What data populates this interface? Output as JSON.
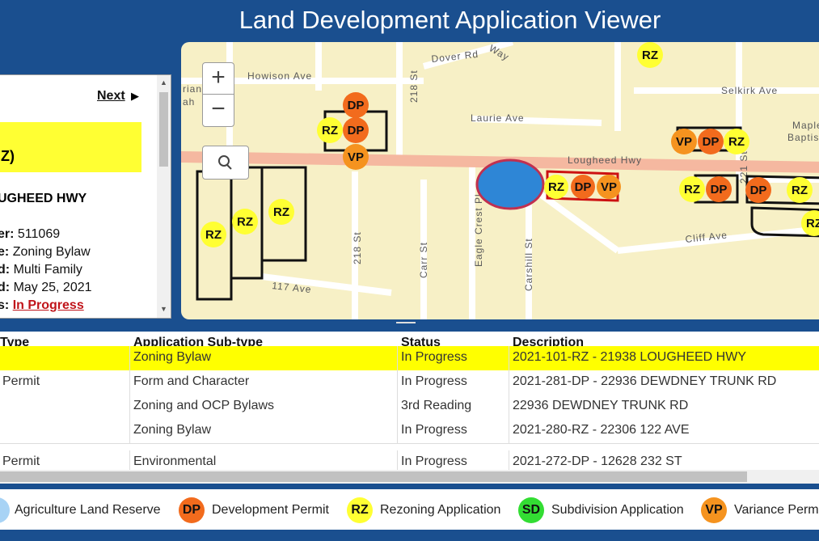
{
  "app": {
    "title": "Land Development Application Viewer"
  },
  "popup": {
    "next_label": "Next",
    "next_arrow": "▶",
    "highlight_line": "Z)",
    "address": "UGHEED HWY",
    "rows": [
      {
        "label": "er:",
        "value": "511069"
      },
      {
        "label": "e:",
        "value": "Zoning Bylaw"
      },
      {
        "label": "d:",
        "value": "Multi Family"
      },
      {
        "label": "d:",
        "value": "May 25, 2021"
      },
      {
        "label": "s:",
        "value": "In Progress"
      }
    ]
  },
  "map": {
    "zoom_in": "+",
    "zoom_out": "−",
    "streets": [
      "Dover Rd",
      "Way",
      "Howison Ave",
      "Selkirk Ave",
      "Laurie Ave",
      "Maple",
      "Baptis",
      "Lougheed Hwy",
      "218 St",
      "221 St",
      "Eagle Crest Pl",
      "Carr St",
      "Carshill St",
      "Cliff Ave",
      "117 Ave",
      "rian",
      "ah"
    ],
    "markers": [
      {
        "code": "RZ",
        "color": "#ffff33"
      },
      {
        "code": "DP",
        "color": "#f26b1d"
      },
      {
        "code": "VP",
        "color": "#f5931f"
      }
    ]
  },
  "grid": {
    "columns": [
      "Type",
      "Application Sub-type",
      "Status",
      "Description"
    ],
    "rows": [
      {
        "type": "",
        "subtype": "Zoning Bylaw",
        "status": "In Progress",
        "description": "2021-101-RZ - 21938 LOUGHEED HWY",
        "selected": true
      },
      {
        "type": "Permit",
        "subtype": "Form and Character",
        "status": "In Progress",
        "description": "2021-281-DP - 22936 DEWDNEY TRUNK RD",
        "selected": false
      },
      {
        "type": "",
        "subtype": "Zoning and OCP Bylaws",
        "status": "3rd Reading",
        "description": "22936 DEWDNEY TRUNK RD",
        "selected": false
      },
      {
        "type": "",
        "subtype": "Zoning Bylaw",
        "status": "In Progress",
        "description": "2021-280-RZ - 22306 122 AVE",
        "selected": false
      },
      {
        "type": "Permit",
        "subtype": "Environmental",
        "status": "In Progress",
        "description": "2021-272-DP - 12628 232 ST",
        "selected": false
      }
    ]
  },
  "legend": [
    {
      "code": "",
      "label": "Agriculture Land Reserve",
      "color": "#a8d3f5"
    },
    {
      "code": "DP",
      "label": "Development Permit",
      "color": "#f26b1d"
    },
    {
      "code": "RZ",
      "label": "Rezoning Application",
      "color": "#ffff33"
    },
    {
      "code": "SD",
      "label": "Subdivision Application",
      "color": "#33dd33"
    },
    {
      "code": "VP",
      "label": "Variance Perm",
      "color": "#f5931f"
    }
  ]
}
